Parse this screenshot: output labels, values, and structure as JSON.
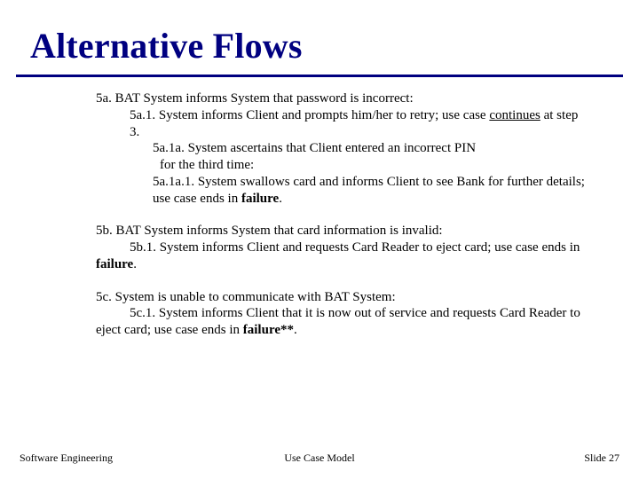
{
  "title": "Alternative Flows",
  "flows": {
    "a": {
      "head": "5a. BAT System informs System that password is incorrect:",
      "s1_pre": "5a.1. System informs Client and prompts him/her to retry; use case ",
      "s1_kw": "continues",
      "s1_post": " at step 3.",
      "s1a_l1": "5a.1a. System ascertains that Client entered an incorrect PIN",
      "s1a_l2": " for the third time:",
      "s1a1_pre": "5a.1a.1. System swallows card and informs Client to see Bank for further details; use case ends in ",
      "s1a1_kw": "failure",
      "s1a1_post": "."
    },
    "b": {
      "head": "5b. BAT System informs System that card information is invalid:",
      "s1_pre": "5b.1. System informs Client and requests Card Reader to eject card; use case ends in ",
      "s1_kw": "failure",
      "s1_post": "."
    },
    "c": {
      "head": "5c. System is unable to communicate with BAT System:",
      "s1_pre": "5c.1. System informs Client that it is now out of service and requests Card Reader to eject card; use case ends in ",
      "s1_kw": "failure**",
      "s1_post": "."
    }
  },
  "footer": {
    "left": "Software Engineering",
    "center": "Use Case Model",
    "right_label": "Slide ",
    "right_num": "27"
  }
}
